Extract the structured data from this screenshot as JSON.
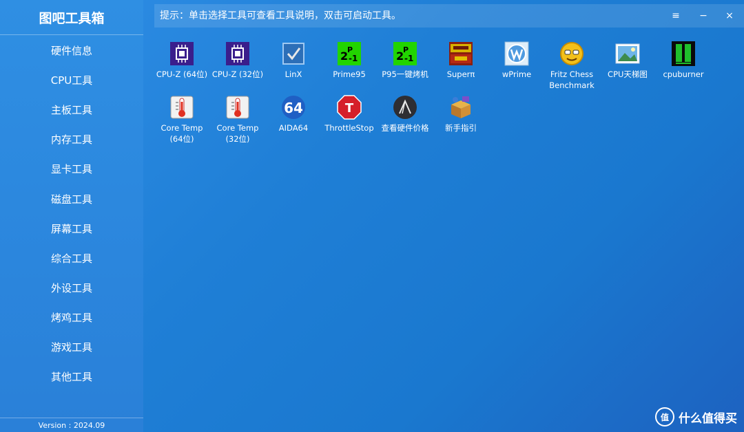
{
  "app": {
    "title": "图吧工具箱",
    "version": "Version : 2024.09"
  },
  "sidebar": {
    "items": [
      {
        "label": "硬件信息"
      },
      {
        "label": "CPU工具"
      },
      {
        "label": "主板工具"
      },
      {
        "label": "内存工具"
      },
      {
        "label": "显卡工具"
      },
      {
        "label": "磁盘工具"
      },
      {
        "label": "屏幕工具"
      },
      {
        "label": "综合工具"
      },
      {
        "label": "外设工具"
      },
      {
        "label": "烤鸡工具"
      },
      {
        "label": "游戏工具"
      },
      {
        "label": "其他工具"
      }
    ]
  },
  "topbar": {
    "hint": "提示：单击选择工具可查看工具说明，双击可启动工具。",
    "menu_icon": "≡",
    "minimize_icon": "−",
    "close_icon": "×"
  },
  "tools": [
    {
      "label": "CPU-Z (64位)",
      "icon": "cpuz-icon"
    },
    {
      "label": "CPU-Z (32位)",
      "icon": "cpuz-icon"
    },
    {
      "label": "LinX",
      "icon": "linx-icon"
    },
    {
      "label": "Prime95",
      "icon": "prime95-icon"
    },
    {
      "label": "P95一键烤机",
      "icon": "prime95-icon"
    },
    {
      "label": "Superπ",
      "icon": "superpi-icon"
    },
    {
      "label": "wPrime",
      "icon": "wprime-icon"
    },
    {
      "label": "Fritz Chess\nBenchmark",
      "icon": "fritz-icon"
    },
    {
      "label": "CPU天梯图",
      "icon": "picture-icon"
    },
    {
      "label": "cpuburner",
      "icon": "cpuburner-icon"
    },
    {
      "label": "Core Temp\n(64位)",
      "icon": "thermometer-icon"
    },
    {
      "label": "Core Temp\n(32位)",
      "icon": "thermometer-icon"
    },
    {
      "label": "AIDA64",
      "icon": "aida64-icon",
      "glyph": "64"
    },
    {
      "label": "ThrottleStop",
      "icon": "throttlestop-icon",
      "glyph": "T"
    },
    {
      "label": "查看硬件价格",
      "icon": "price-icon"
    },
    {
      "label": "新手指引",
      "icon": "guide-icon"
    }
  ],
  "watermark": {
    "text": "什么值得买",
    "logo": "值"
  }
}
